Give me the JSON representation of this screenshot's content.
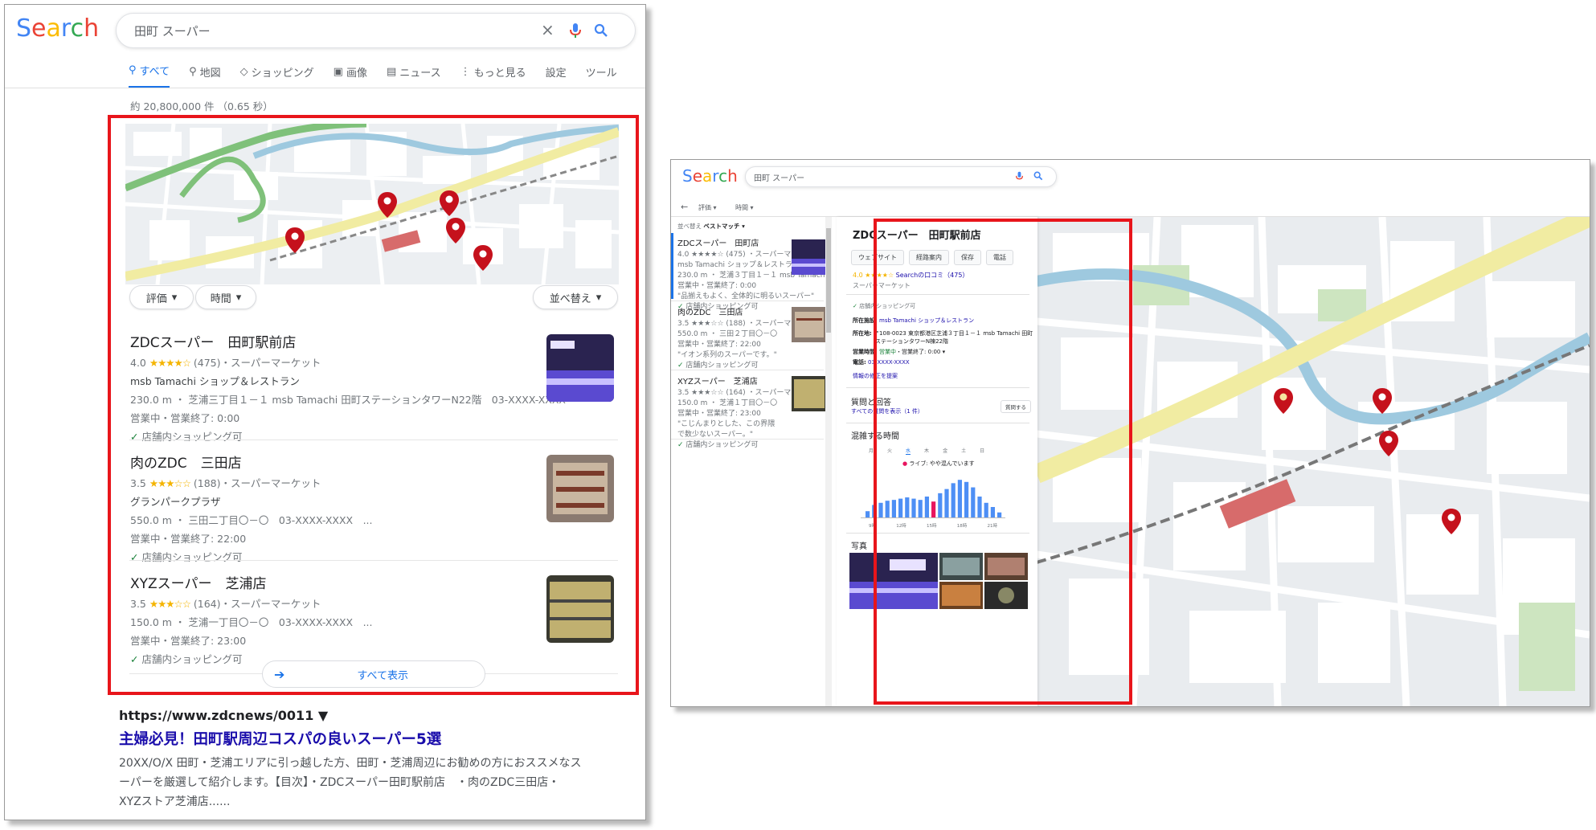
{
  "left": {
    "logo": "Search",
    "query": "田町 スーパー",
    "tabs": [
      "すべて",
      "地図",
      "ショッピング",
      "画像",
      "ニュース",
      "もっと見る",
      "設定",
      "ツール"
    ],
    "result_stats": "約 20,800,000 件 （0.65 秒）",
    "filters": {
      "rating": "評価",
      "hours": "時間",
      "sort": "並べ替え"
    },
    "businesses": [
      {
        "name": "ZDCスーパー　田町駅前店",
        "rating": "4.0",
        "stars": "★★★★☆",
        "reviews": "(475)",
        "category": "・スーパーマーケット",
        "sub": "msb Tamachi ショップ＆レストラン",
        "address": "230.0 m ・ 芝浦三丁目１－１ msb Tamachi 田町ステーションタワーN22階　03-XXXX-XXXX",
        "hours": "営業中・営業終了: 0:00",
        "feature": "店舗内ショッピング可"
      },
      {
        "name": "肉のZDC　三田店",
        "rating": "3.5",
        "stars": "★★★☆☆",
        "reviews": "(188)",
        "category": "・スーパーマーケット",
        "sub": "グランパークプラザ",
        "address": "550.0 m ・ 三田二丁目〇－〇　03-XXXX-XXXX　...",
        "hours": "営業中・営業終了: 22:00",
        "feature": "店舗内ショッピング可"
      },
      {
        "name": "XYZスーパー　芝浦店",
        "rating": "3.5",
        "stars": "★★★☆☆",
        "reviews": "(164)",
        "category": "・スーパーマーケット",
        "sub": "",
        "address": "150.0 m ・ 芝浦一丁目〇－〇　03-XXXX-XXXX　...",
        "hours": "営業中・営業終了: 23:00",
        "feature": "店舗内ショッピング可"
      }
    ],
    "show_all": "すべて表示",
    "organic": {
      "url": "https://www.zdcnews/0011 ▼",
      "title": "主婦必見！田町駅周辺コスパの良いスーパー5選",
      "snippet1": "20XX/O/X 田町・芝浦エリアに引っ越した方、田町・芝浦周辺にお勧めの方におススメなス",
      "snippet2": "ーパーを厳選して紹介します。【目次】・ZDCスーパー田町駅前店　・肉のZDC三田店・",
      "snippet3": "XYZストア芝浦店......"
    }
  },
  "right": {
    "logo": "Search",
    "query": "田町 スーパー",
    "filters": {
      "rating": "評価 ▾",
      "hours": "時間 ▾"
    },
    "sort_label": "並べ替え",
    "sort_value": "ベストマッチ ▾",
    "list": [
      {
        "name": "ZDCスーパー　田町店",
        "l1": "4.0 ★★★★☆ (475) ・スーパーマーケ...",
        "l2": "msb Tamachi ショップ＆レストラン",
        "l3": "230.0 m ・ 芝浦３丁目１－１ msb Tamachi",
        "l4": "営業中・営業終了: 0:00",
        "l5": "\"品揃えもよく、全体的に明るいスーパー\"",
        "l6": "店舗内ショッピング可"
      },
      {
        "name": "肉のZDC　三田店",
        "l1": "3.5 ★★★☆☆ (188) ・スーパーマーケ...",
        "l2": "",
        "l3": "550.0 m ・ 三田２丁目〇－〇",
        "l4": "営業中・営業終了: 22:00",
        "l5": "\"イオン系列のスーパーです。\"",
        "l6": "店舗内ショッピング可"
      },
      {
        "name": "XYZスーパー　芝浦店",
        "l1": "3.5 ★★★☆☆ (164) ・スーパーマーケ...",
        "l2": "150.0 m ・ 芝浦１丁目〇－〇",
        "l3": "営業中・営業終了: 23:00",
        "l4": "",
        "l5": "\"こじんまりとした、この界隈で数少ないスーパー。\"",
        "l6": "店舗内ショッピング可"
      }
    ],
    "detail": {
      "name": "ZDCスーパー　田町駅前店",
      "buttons": [
        "ウェブサイト",
        "経路案内",
        "保存",
        "電話"
      ],
      "rating": "4.0 ★★★★☆",
      "reviews": "Searchの口コミ（475）",
      "category": "スーパーマーケット",
      "feature": "店舗内ショッピング可",
      "facility_label": "所在施設:",
      "facility": "msb Tamachi ショップ＆レストラン",
      "address_label": "所在地:",
      "address1": "〒108-0023 東京都港区芝浦３丁目１－１ msb Tamachi 田町",
      "address2": "ステーションタワーN棟22階",
      "hours_label": "営業時間:",
      "hours_open": "営業中",
      "hours_rest": "・営業終了: 0:00 ▾",
      "phone_label": "電話:",
      "phone": "03-XXXX-XXXX",
      "edit": "情報の修正を提案",
      "qa_title": "質問と回答",
      "qa_link": "すべての質問を表示（1 件）",
      "qa_button": "質問する",
      "busy_title": "混雑する時間",
      "days": [
        "月",
        "火",
        "水",
        "木",
        "金",
        "土",
        "日"
      ],
      "live": "ライブ: やや混んでいます",
      "time_ticks": [
        "9時",
        "12時",
        "15時",
        "18時",
        "21時"
      ],
      "photos_title": "写真",
      "busy_values": [
        0.15,
        0.3,
        0.35,
        0.4,
        0.42,
        0.45,
        0.48,
        0.45,
        0.42,
        0.5,
        0.38,
        0.58,
        0.68,
        0.82,
        0.9,
        0.85,
        0.72,
        0.5,
        0.35,
        0.25,
        0.12
      ]
    }
  },
  "colors": {
    "accent": "#1a73e8",
    "highlight": "#e8151b",
    "pin": "#c5111c",
    "live": "#e8155f",
    "bar": "#4e8ff5"
  }
}
